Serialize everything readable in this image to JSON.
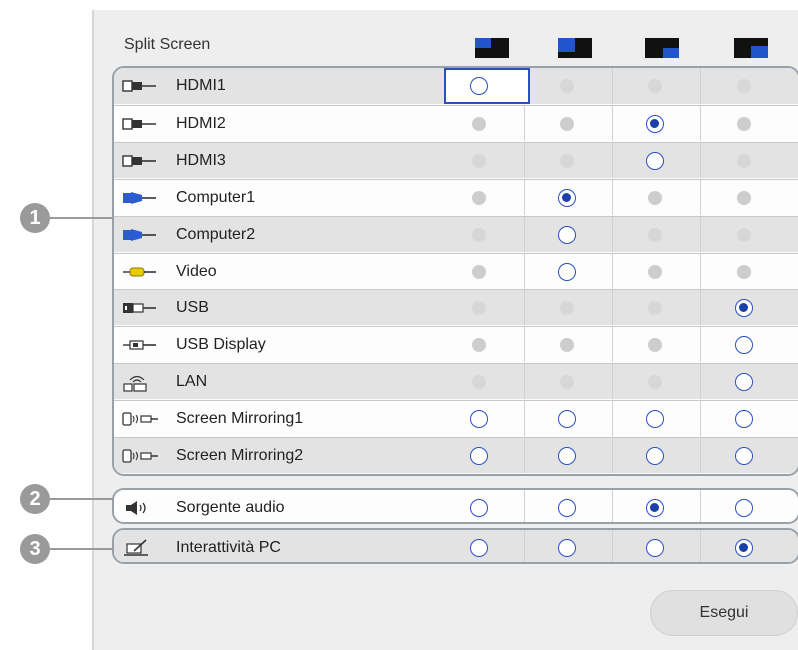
{
  "header": {
    "title": "Split Screen"
  },
  "layout_icons": [
    "layout-left-top-icon",
    "layout-left-icon",
    "layout-right-top-icon",
    "layout-right-icon"
  ],
  "sources": [
    {
      "label": "HDMI1",
      "icon": "hdmi-icon",
      "states": [
        "open-focused",
        "disabled",
        "disabled",
        "disabled"
      ]
    },
    {
      "label": "HDMI2",
      "icon": "hdmi-icon",
      "states": [
        "disabled",
        "disabled",
        "selected",
        "disabled"
      ]
    },
    {
      "label": "HDMI3",
      "icon": "hdmi-icon",
      "states": [
        "disabled",
        "disabled",
        "open",
        "disabled"
      ]
    },
    {
      "label": "Computer1",
      "icon": "computer-icon",
      "states": [
        "disabled",
        "selected",
        "disabled",
        "disabled"
      ]
    },
    {
      "label": "Computer2",
      "icon": "computer-icon",
      "states": [
        "disabled",
        "open",
        "disabled",
        "disabled"
      ]
    },
    {
      "label": "Video",
      "icon": "video-icon",
      "states": [
        "disabled",
        "open",
        "disabled",
        "disabled"
      ]
    },
    {
      "label": "USB",
      "icon": "usb-icon",
      "states": [
        "disabled",
        "disabled",
        "disabled",
        "selected"
      ]
    },
    {
      "label": "USB Display",
      "icon": "usb-display-icon",
      "states": [
        "disabled",
        "disabled",
        "disabled",
        "open"
      ]
    },
    {
      "label": "LAN",
      "icon": "lan-icon",
      "states": [
        "disabled",
        "disabled",
        "disabled",
        "open"
      ]
    },
    {
      "label": "Screen Mirroring1",
      "icon": "screen-mirroring-icon",
      "states": [
        "open",
        "open",
        "open",
        "open"
      ]
    },
    {
      "label": "Screen Mirroring2",
      "icon": "screen-mirroring-icon",
      "states": [
        "open",
        "open",
        "open",
        "open"
      ]
    }
  ],
  "audio": {
    "label": "Sorgente audio",
    "icon": "speaker-icon",
    "states": [
      "open",
      "open",
      "selected",
      "open"
    ]
  },
  "pc": {
    "label": "Interattività PC",
    "icon": "pen-tablet-icon",
    "states": [
      "open",
      "open",
      "open",
      "selected"
    ]
  },
  "callouts": [
    "1",
    "2",
    "3"
  ],
  "run_button": {
    "label": "Esegui"
  },
  "colors": {
    "accent": "#2a4fc0",
    "selected_dot": "#1c3fa8",
    "callout": "#9a9a9a",
    "panel": "#eeeeee"
  }
}
